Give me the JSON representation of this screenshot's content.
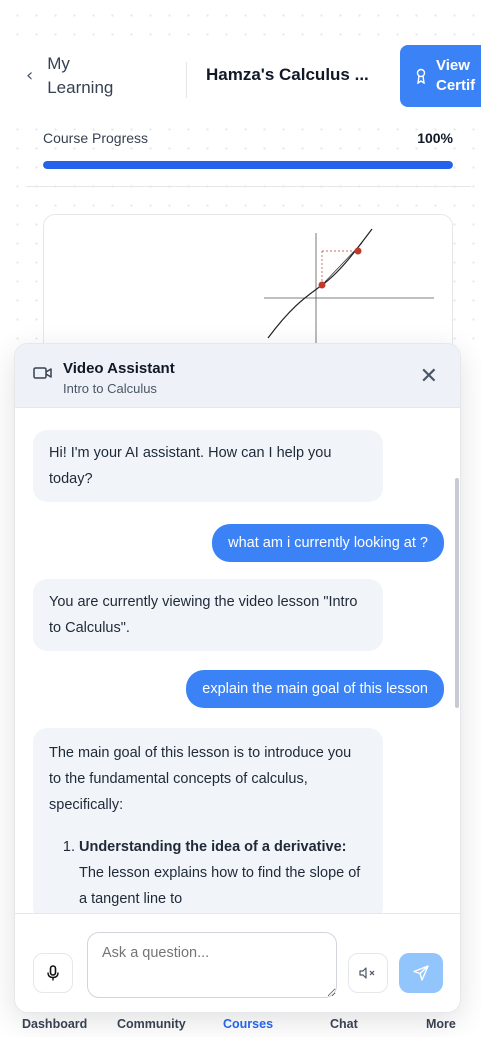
{
  "header": {
    "back_label": "My Learning",
    "title": "Hamza's Calculus ...",
    "cert_button_label": "View Certif"
  },
  "progress": {
    "label": "Course Progress",
    "percent_text": "100%",
    "value": 1.0
  },
  "video_assistant": {
    "title": "Video Assistant",
    "subtitle": "Intro to Calculus",
    "messages": [
      {
        "role": "assistant",
        "text": "Hi! I'm your AI assistant. How can I help you today?"
      },
      {
        "role": "user",
        "text": "what am i currently looking at ?"
      },
      {
        "role": "assistant",
        "text": "You are currently viewing the video lesson \"Intro to Calculus\"."
      },
      {
        "role": "user",
        "text": "explain the main goal of this lesson"
      },
      {
        "role": "assistant",
        "text": "The main goal of this lesson is to introduce you to the fundamental concepts of calculus, specifically:",
        "list_item_bold": "Understanding the idea of a derivative:",
        "list_item_text": " The lesson explains how to find the slope of a tangent line to"
      }
    ],
    "input_placeholder": "Ask a question..."
  },
  "bottom_nav": {
    "items": [
      "Dashboard",
      "Community",
      "Courses",
      "Chat",
      "More"
    ],
    "active": "Courses"
  },
  "colors": {
    "accent": "#3b82f6",
    "send_disabled": "#93c5fd",
    "progress_fill": "#2563eb"
  }
}
